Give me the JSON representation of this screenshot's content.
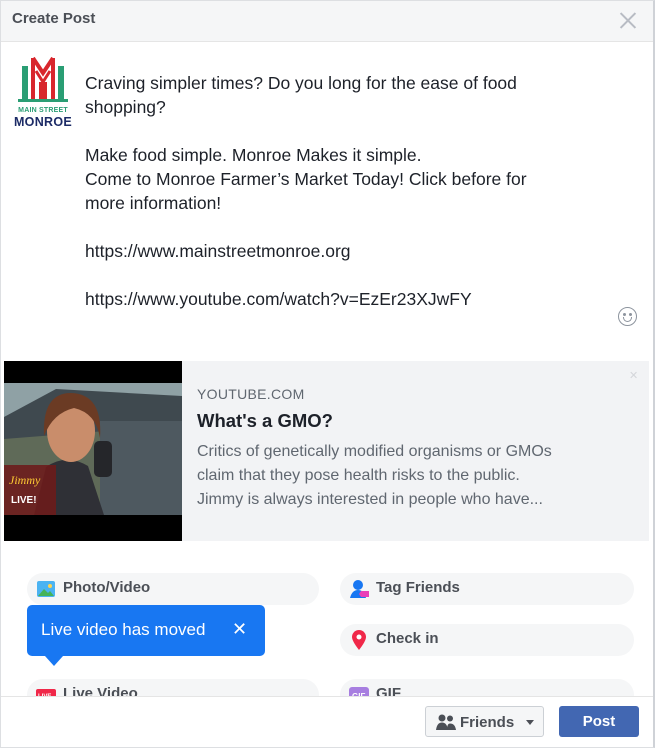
{
  "dialog": {
    "title": "Create Post"
  },
  "page_avatar": {
    "line_small": "MAIN STREET",
    "line_big": "MONROE"
  },
  "post": {
    "lines": [
      "Craving simpler times? Do you long for the ease of food",
      "shopping?",
      "",
      "Make food simple. Monroe Makes it simple.",
      "Come to Monroe Farmer’s Market Today! Click before for",
      "more information!",
      "",
      "https://www.mainstreetmonroe.org",
      "",
      "https://www.youtube.com/watch?v=EzEr23XJwFY"
    ]
  },
  "link_preview": {
    "source": "YOUTUBE.COM",
    "title": "What's a GMO?",
    "description_lines": [
      "Critics of genetically modified organisms or GMOs",
      "claim that they pose health risks to the public.",
      "Jimmy is always interested in people who have..."
    ]
  },
  "actions": [
    {
      "label": "Photo/Video",
      "icon": "photo-video-icon"
    },
    {
      "label": "Tag Friends",
      "icon": "tag-friends-icon"
    },
    {
      "label": "Check in",
      "icon": "check-in-icon"
    },
    {
      "label": "Live Video",
      "icon": "live-video-icon"
    },
    {
      "label": "GIF",
      "icon": "gif-icon"
    }
  ],
  "tooltip": {
    "text": "Live video has moved",
    "close": "✕"
  },
  "footer": {
    "audience_label": "Friends",
    "post_label": "Post"
  },
  "colors": {
    "facebook_blue": "#4267b2",
    "tooltip_blue": "#1877f2"
  }
}
